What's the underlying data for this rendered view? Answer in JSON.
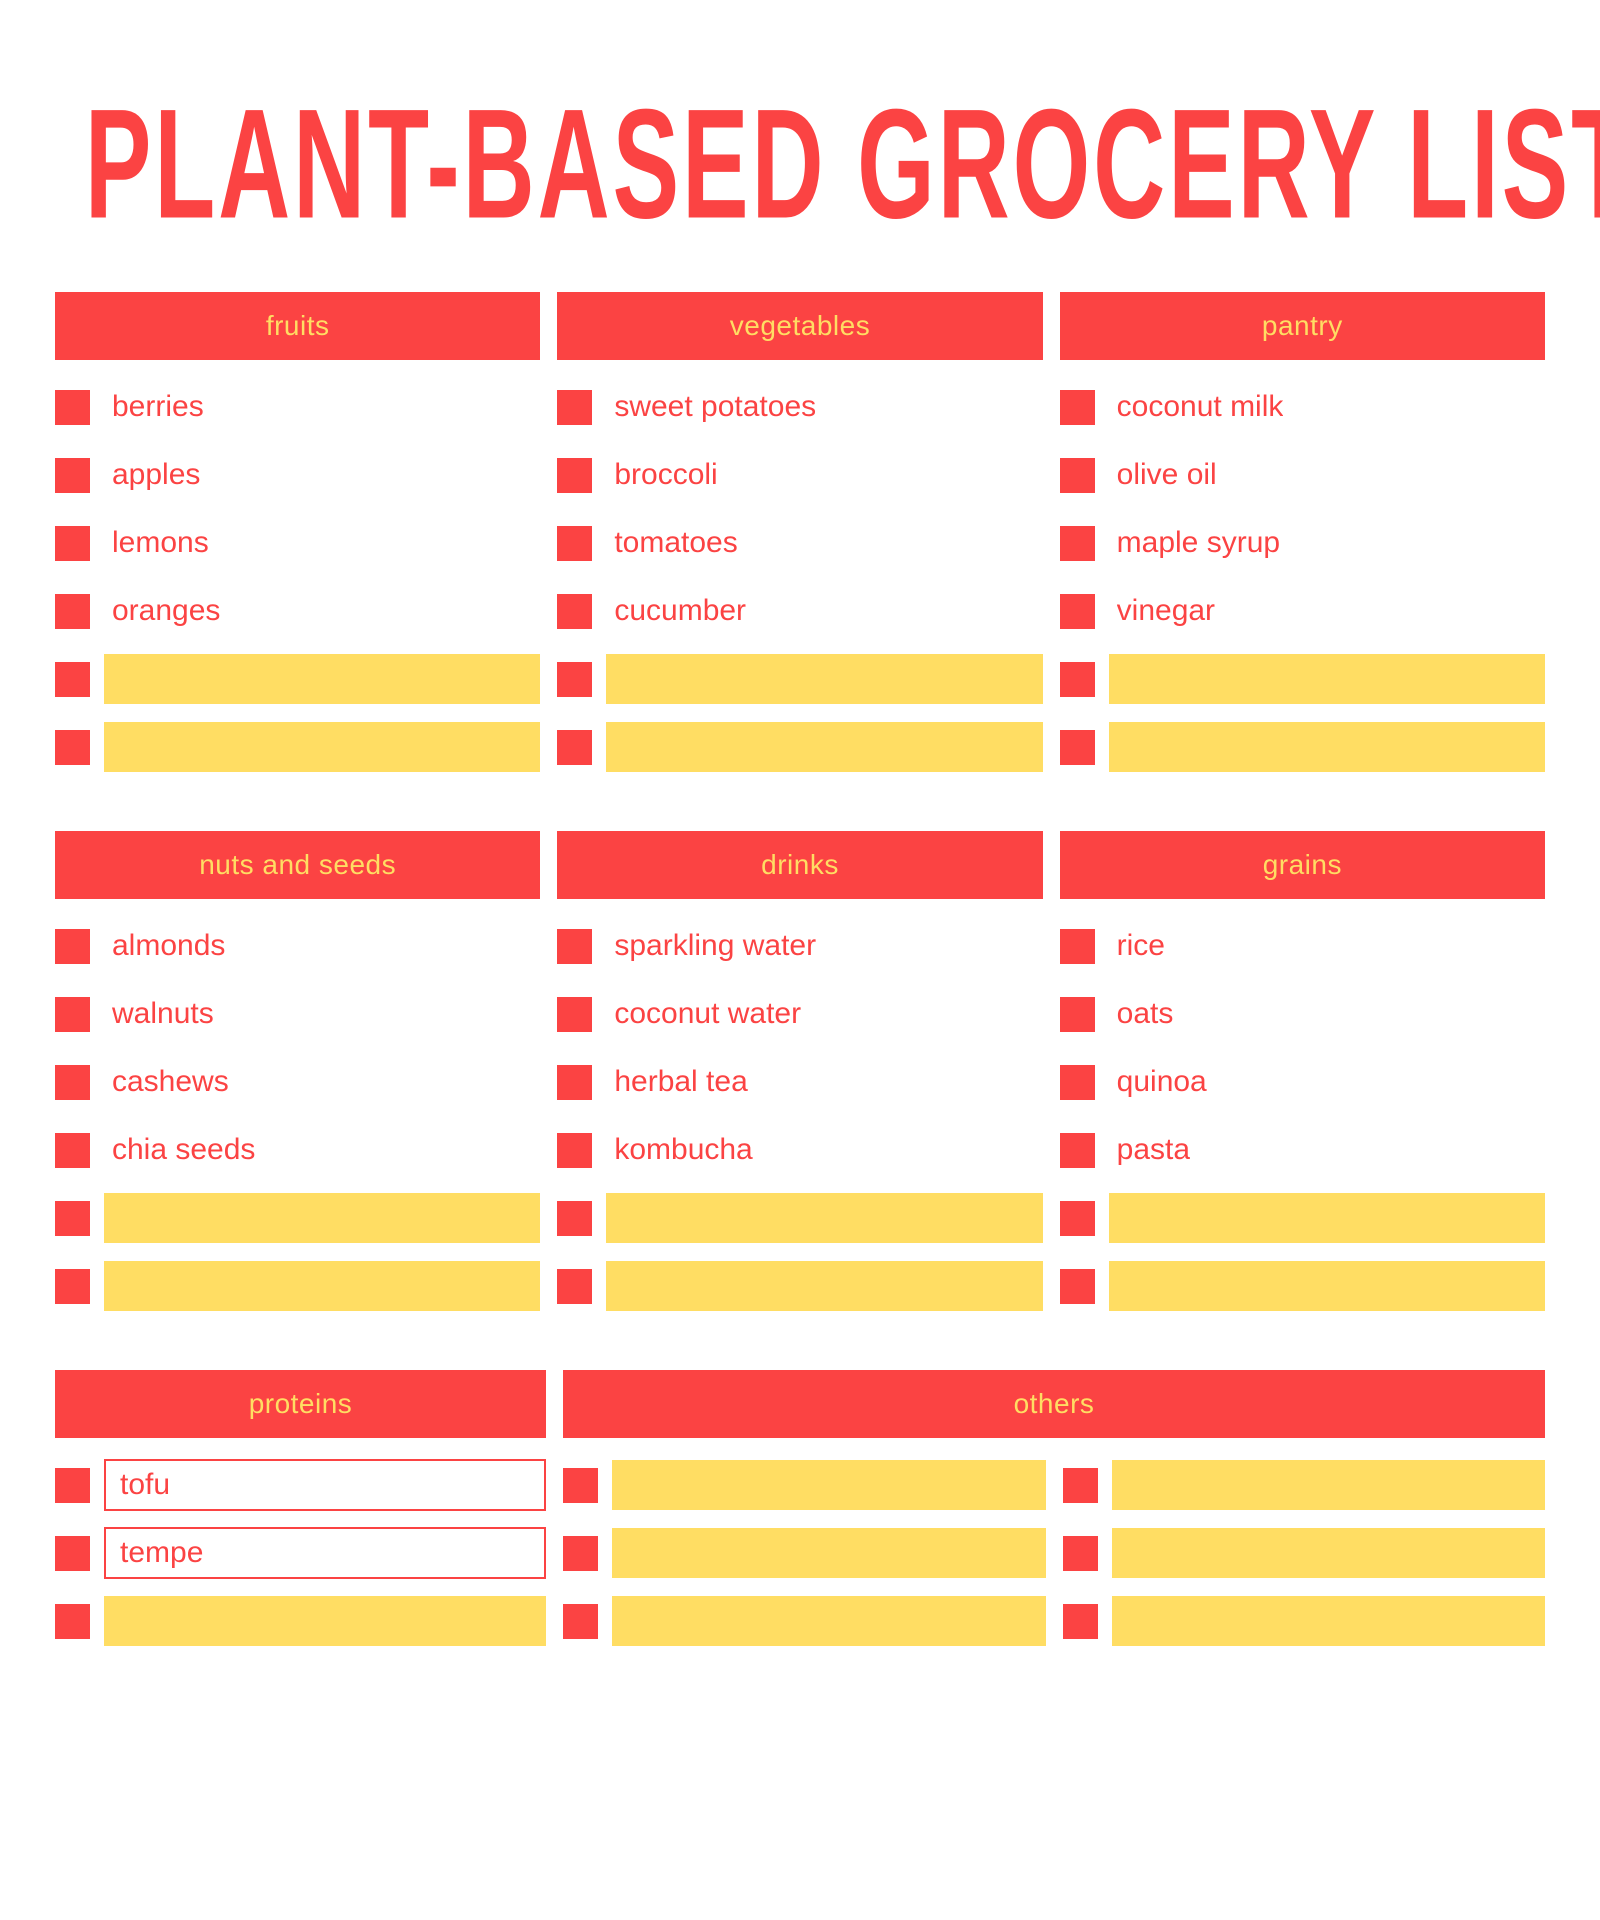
{
  "document": {
    "title": "PLANT-BASED GROCERY LIST"
  },
  "colors": {
    "red": "#fb4343",
    "yellow": "#ffdd63",
    "background": "#ffffff"
  },
  "blocks": [
    {
      "id": "block-1",
      "columns": [
        {
          "id": "fruits",
          "header": "fruits",
          "items": [
            {
              "type": "text",
              "label": "berries"
            },
            {
              "type": "text",
              "label": "apples"
            },
            {
              "type": "text",
              "label": "lemons"
            },
            {
              "type": "text",
              "label": "oranges"
            },
            {
              "type": "blank",
              "label": ""
            },
            {
              "type": "blank",
              "label": ""
            }
          ]
        },
        {
          "id": "vegetables",
          "header": "vegetables",
          "items": [
            {
              "type": "text",
              "label": "sweet potatoes"
            },
            {
              "type": "text",
              "label": "broccoli"
            },
            {
              "type": "text",
              "label": "tomatoes"
            },
            {
              "type": "text",
              "label": "cucumber"
            },
            {
              "type": "blank",
              "label": ""
            },
            {
              "type": "blank",
              "label": ""
            }
          ]
        },
        {
          "id": "pantry",
          "header": "pantry",
          "items": [
            {
              "type": "text",
              "label": "coconut milk"
            },
            {
              "type": "text",
              "label": "olive oil"
            },
            {
              "type": "text",
              "label": "maple syrup"
            },
            {
              "type": "text",
              "label": "vinegar"
            },
            {
              "type": "blank",
              "label": ""
            },
            {
              "type": "blank",
              "label": ""
            }
          ]
        }
      ]
    },
    {
      "id": "block-2",
      "columns": [
        {
          "id": "nuts-and-seeds",
          "header": "nuts and seeds",
          "items": [
            {
              "type": "text",
              "label": "almonds"
            },
            {
              "type": "text",
              "label": "walnuts"
            },
            {
              "type": "text",
              "label": "cashews"
            },
            {
              "type": "text",
              "label": "chia seeds"
            },
            {
              "type": "blank",
              "label": ""
            },
            {
              "type": "blank",
              "label": ""
            }
          ]
        },
        {
          "id": "drinks",
          "header": "drinks",
          "items": [
            {
              "type": "text",
              "label": "sparkling water"
            },
            {
              "type": "text",
              "label": "coconut water"
            },
            {
              "type": "text",
              "label": "herbal tea"
            },
            {
              "type": "text",
              "label": "kombucha"
            },
            {
              "type": "blank",
              "label": ""
            },
            {
              "type": "blank",
              "label": ""
            }
          ]
        },
        {
          "id": "grains",
          "header": "grains",
          "items": [
            {
              "type": "text",
              "label": "rice"
            },
            {
              "type": "text",
              "label": "oats"
            },
            {
              "type": "text",
              "label": "quinoa"
            },
            {
              "type": "text",
              "label": "pasta"
            },
            {
              "type": "blank",
              "label": ""
            },
            {
              "type": "blank",
              "label": ""
            }
          ]
        }
      ]
    },
    {
      "id": "block-3",
      "columns": [
        {
          "id": "proteins",
          "header": "proteins",
          "items": [
            {
              "type": "input",
              "label": "tofu"
            },
            {
              "type": "input",
              "label": "tempe"
            },
            {
              "type": "blank",
              "label": ""
            }
          ]
        },
        {
          "id": "others",
          "header": "others",
          "wide": true,
          "subcolumns": [
            {
              "id": "others-left",
              "items": [
                {
                  "type": "blank",
                  "label": ""
                },
                {
                  "type": "blank",
                  "label": ""
                },
                {
                  "type": "blank",
                  "label": ""
                }
              ]
            },
            {
              "id": "others-right",
              "items": [
                {
                  "type": "blank",
                  "label": ""
                },
                {
                  "type": "blank",
                  "label": ""
                },
                {
                  "type": "blank",
                  "label": ""
                }
              ]
            }
          ]
        }
      ]
    }
  ]
}
